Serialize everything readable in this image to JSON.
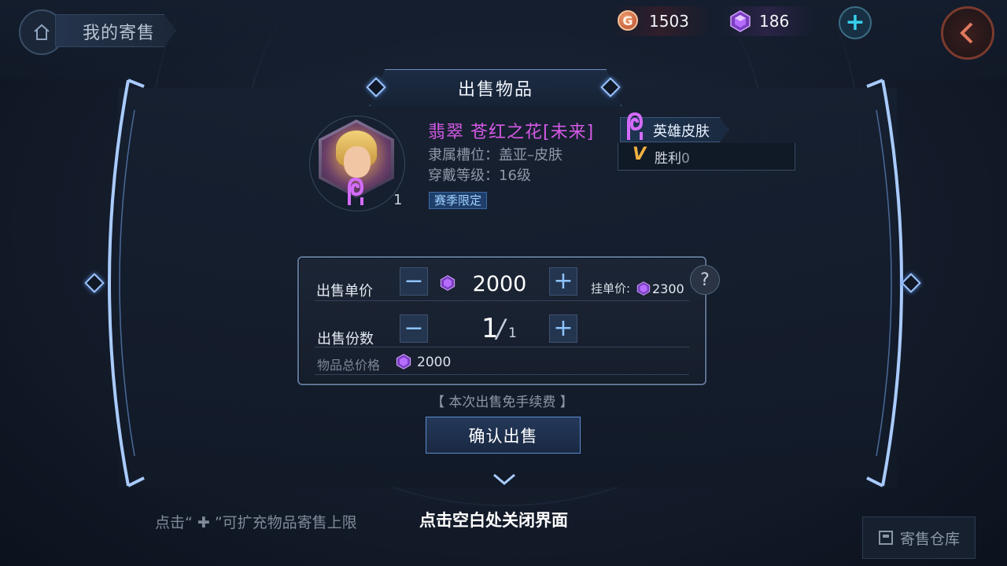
{
  "header": {
    "title": "我的寄售",
    "currencies": [
      {
        "icon": "gold-coin-icon",
        "symbol": "G",
        "value": "1503"
      },
      {
        "icon": "purple-gem-icon",
        "value": "186"
      }
    ]
  },
  "modal": {
    "title": "出售物品",
    "item": {
      "name": "翡翠 苍红之花[未来]",
      "slot_line": "隶属槽位：盖亚–皮肤",
      "level_line": "穿戴等级：16级",
      "tag": "赛季限定",
      "quantity": "1",
      "type": "英雄皮肤",
      "victory_label": "胜利",
      "victory_value": "0",
      "victory_icon": "V"
    },
    "price": {
      "unit_label": "出售单价",
      "unit_value": "2000",
      "listed_label": "挂单价:",
      "listed_value": "2300",
      "count_label": "出售份数",
      "count_value": "1",
      "count_max": "1",
      "total_label": "物品总价格",
      "total_value": "2000",
      "minus": "−",
      "plus": "+",
      "help": "?"
    },
    "fee_note": "【 本次出售免手续费 】",
    "confirm_label": "确认出售"
  },
  "footer": {
    "hint_left": "点击“ ✚ ”可扩充物品寄售上限",
    "hint_close": "点击空白处关闭界面",
    "warehouse_label": "寄售仓库"
  },
  "colors": {
    "accent": "#9cc4ff",
    "item_name": "#d659e6",
    "gem": "#b66cff"
  }
}
